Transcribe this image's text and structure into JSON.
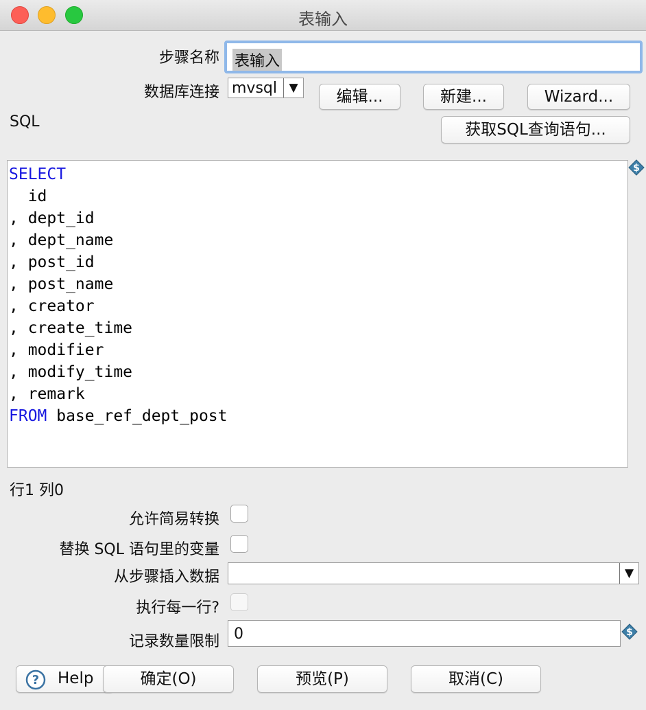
{
  "window": {
    "title": "表输入"
  },
  "form": {
    "step_name_label": "步骤名称",
    "step_name_value": "表输入",
    "db_conn_label": "数据库连接",
    "db_conn_value": "mvsql",
    "sql_label": "SQL"
  },
  "buttons": {
    "edit": "编辑...",
    "new": "新建...",
    "wizard": "Wizard...",
    "get_sql": "获取SQL查询语句...",
    "help": "Help",
    "ok": "确定(O)",
    "preview": "预览(P)",
    "cancel": "取消(C)"
  },
  "sql": {
    "lines": [
      {
        "kw": "SELECT",
        "text": ""
      },
      {
        "kw": "",
        "text": "  id"
      },
      {
        "kw": "",
        "text": ", dept_id"
      },
      {
        "kw": "",
        "text": ", dept_name"
      },
      {
        "kw": "",
        "text": ", post_id"
      },
      {
        "kw": "",
        "text": ", post_name"
      },
      {
        "kw": "",
        "text": ", creator"
      },
      {
        "kw": "",
        "text": ", create_time"
      },
      {
        "kw": "",
        "text": ", modifier"
      },
      {
        "kw": "",
        "text": ", modify_time"
      },
      {
        "kw": "",
        "text": ", remark"
      },
      {
        "kw": "FROM",
        "text": " base_ref_dept_post"
      }
    ],
    "keyword_color": "#1818e0"
  },
  "status": {
    "cursor_pos": "行1 列0"
  },
  "options": {
    "lazy_conversion_label": "允许简易转换",
    "replace_vars_label": "替换 SQL 语句里的变量",
    "insert_from_step_label": "从步骤插入数据",
    "insert_from_step_value": "",
    "execute_each_row_label": "执行每一行?",
    "limit_label": "记录数量限制",
    "limit_value": "0"
  },
  "icons": {
    "dropdown": "▼",
    "variable": "dollar-diamond-icon",
    "help": "help-icon"
  }
}
